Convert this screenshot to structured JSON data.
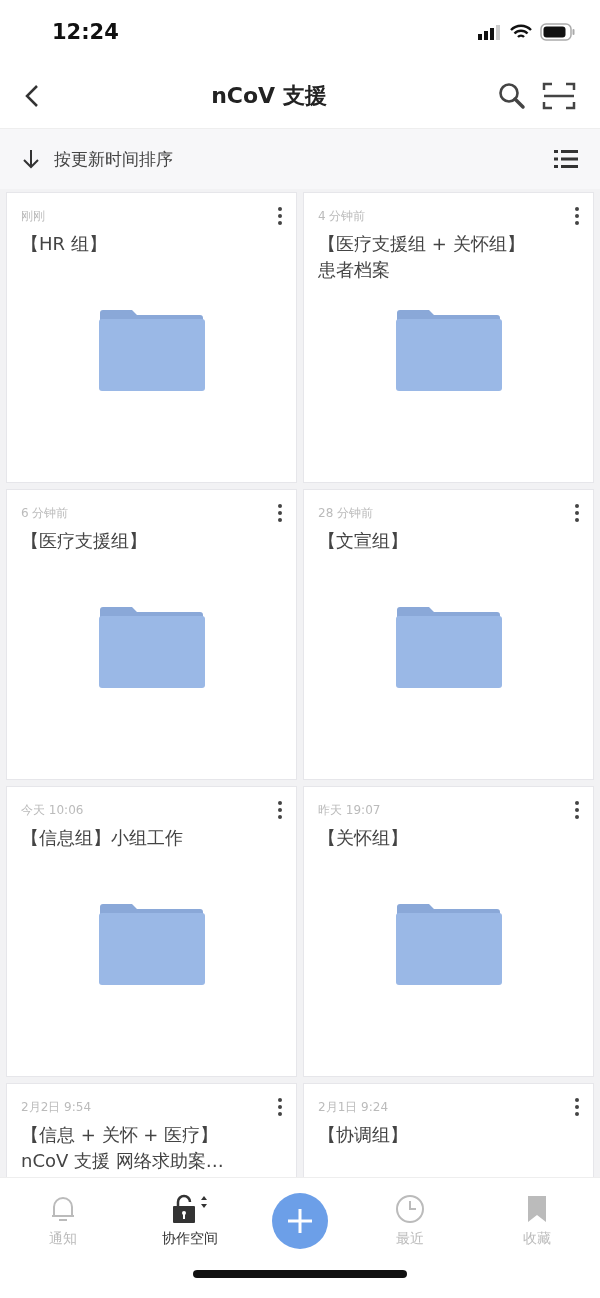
{
  "status_bar": {
    "time": "12:24"
  },
  "header": {
    "title": "nCoV 支援"
  },
  "sort_bar": {
    "label": "按更新时间排序"
  },
  "folders": [
    {
      "time": "刚刚",
      "name": "【HR 组】"
    },
    {
      "time": "4 分钟前",
      "name": "【医疗支援组 + 关怀组】患者档案"
    },
    {
      "time": "6 分钟前",
      "name": "【医疗支援组】"
    },
    {
      "time": "28 分钟前",
      "name": "【文宣组】"
    },
    {
      "time": "今天 10:06",
      "name": "【信息组】小组工作"
    },
    {
      "time": "昨天 19:07",
      "name": "【关怀组】"
    },
    {
      "time": "2月2日 9:54",
      "name": "【信息 + 关怀 + 医疗】nCoV 支援 网络求助案…"
    },
    {
      "time": "2月1日 9:24",
      "name": "【协调组】"
    }
  ],
  "tab_bar": {
    "tabs": [
      {
        "kind": "bell",
        "label": "通知",
        "selected": false
      },
      {
        "kind": "lock",
        "label": "协作空间",
        "selected": true
      },
      {
        "kind": "fab"
      },
      {
        "kind": "clock",
        "label": "最近",
        "selected": false
      },
      {
        "kind": "bookmark",
        "label": "收藏",
        "selected": false
      }
    ]
  }
}
